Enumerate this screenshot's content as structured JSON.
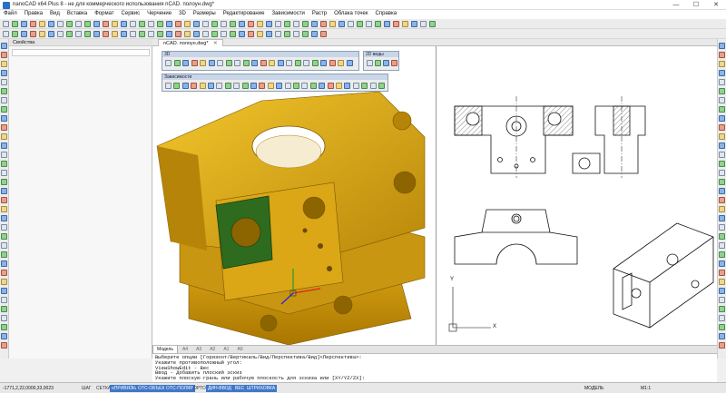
{
  "window": {
    "title": "nanoCAD x64 Plus 8 - не для коммерческого использования nCAD. полоун.dwg*",
    "minimize": "—",
    "maximize": "☐",
    "close": "✕"
  },
  "menu": [
    "Файл",
    "Правка",
    "Вид",
    "Вставка",
    "Формат",
    "Сервис",
    "Черчение",
    "3D",
    "Размеры",
    "Редактирование",
    "Зависимости",
    "Растр",
    "Облака точек",
    "Справка"
  ],
  "props_panel": {
    "title": "Свойства"
  },
  "document_tab": {
    "label": "nCAD. полоун.dwg*",
    "close": "✕"
  },
  "floating_toolbars": {
    "t3d": "3D",
    "t2d": "2D виды",
    "constraints": "Зависимости"
  },
  "model_tabs": [
    "Модель",
    "А4",
    "А3",
    "А2",
    "А1",
    "А0"
  ],
  "command_lines": [
    "Выберите опции [Горизонт/Вертикаль/Вид/Перспектива/Вид]<Перспектива>:",
    "Укажите противоположный угол:",
    "ViewShowEdit - Вес",
    "Ввод - Добавить плоский эскиз",
    "Укажите плоскую грань или рабочую плоскость для эскиза или [XY/YZ/ZX]:"
  ],
  "status": {
    "coords": "-1771,2,22,0000,33,0023",
    "buttons": [
      {
        "label": "ШАГ",
        "on": false
      },
      {
        "label": "СЕТКА",
        "on": false
      },
      {
        "label": "оПРИВЯЗКА",
        "on": true
      },
      {
        "label": "ОТС-ОБЪЕКТ",
        "on": true
      },
      {
        "label": "ОТС-ПОЛЯР",
        "on": true
      },
      {
        "label": "ОРТО",
        "on": false
      },
      {
        "label": "ДИН-ВВОД",
        "on": true
      },
      {
        "label": "ВЕС",
        "on": true
      },
      {
        "label": "ШТРИХОВКА",
        "on": true
      }
    ],
    "model": "МОДЕЛЬ",
    "scale": "М1:1"
  },
  "colors": {
    "accent": "#3f77c9",
    "part": "#d4a10a",
    "face_green": "#2e6b1e"
  },
  "axis_labels": {
    "x": "X",
    "y": "Y"
  }
}
